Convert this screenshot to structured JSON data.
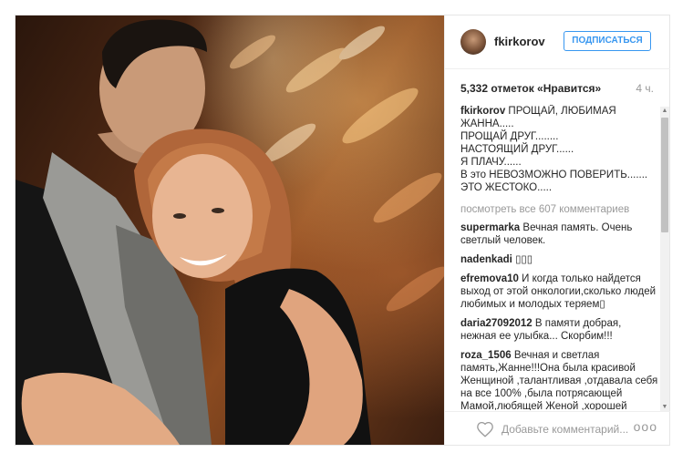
{
  "post": {
    "username": "fkirkorov",
    "follow_label": "ПОДПИСАТЬСЯ",
    "likes": "5,332 отметок «Нравится»",
    "time": "4 ч.",
    "caption_user": "fkirkorov",
    "caption_lines": [
      "ПРОЩАЙ, ЛЮБИМАЯ",
      "ЖАННА.....",
      "ПРОЩАЙ ДРУГ........",
      "НАСТОЯЩИЙ ДРУГ......",
      "Я ПЛАЧУ......",
      "В это НЕВОЗМОЖНО ПОВЕРИТЬ.......",
      "ЭТО ЖЕСТОКО....."
    ],
    "view_all": "посмотреть все 607 комментариев",
    "comment_placeholder": "Добавьте комментарий...",
    "more": "ooo"
  },
  "comments": [
    {
      "user": "supermarka",
      "text": "Вечная память. Очень светлый человек."
    },
    {
      "user": "nadenkadi",
      "text": "▯▯▯"
    },
    {
      "user": "efremova10",
      "text": "И когда только найдется выход от этой онкологии,сколько людей любимых и молодых теряем▯"
    },
    {
      "user": "daria27092012",
      "text": "В памяти добрая, нежная ее улыбка... Скорбим!!!"
    },
    {
      "user": "roza_1506",
      "text": "Вечная и светлая память,Жанне!!!Она была красивой Женщиной ,талантливая ,отдавала себя на все 100% ,была потрясающей Мамой,любящей Женой ,хорошей дочерью и сестрой,Жаль ,такая потеря..."
    }
  ],
  "icons": {
    "heart": "heart-icon",
    "avatar": "avatar",
    "scroll_up": "chevron-up-icon",
    "scroll_down": "chevron-down-icon"
  },
  "colors": {
    "accent": "#3897f0",
    "muted": "#999999",
    "border": "#e6e6e6"
  }
}
